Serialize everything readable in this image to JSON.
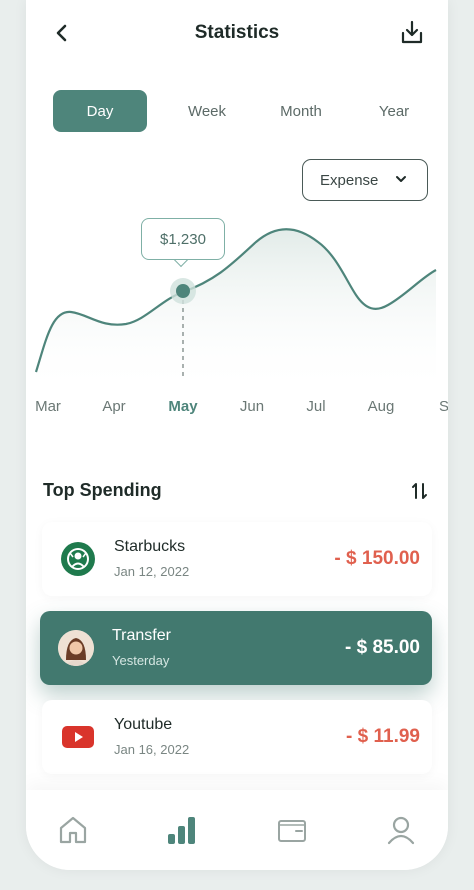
{
  "header": {
    "title": "Statistics",
    "back_icon": "chevron-left-icon",
    "download_icon": "download-icon"
  },
  "tabs": [
    {
      "label": "Day",
      "active": true
    },
    {
      "label": "Week",
      "active": false
    },
    {
      "label": "Month",
      "active": false
    },
    {
      "label": "Year",
      "active": false
    }
  ],
  "filter": {
    "selected": "Expense",
    "icon": "chevron-down-icon"
  },
  "chart_data": {
    "type": "area",
    "categories": [
      "Mar",
      "Apr",
      "May",
      "Jun",
      "Jul",
      "Aug",
      "S"
    ],
    "highlight": {
      "category": "May",
      "label": "$1,230"
    },
    "series_color": "#4e857b",
    "grid": false
  },
  "spending": {
    "title": "Top Spending",
    "sort_icon": "sort-icon",
    "items": [
      {
        "name": "Starbucks",
        "date": "Jan 12, 2022",
        "amount": "- $ 150.00",
        "icon": "starbucks-logo-icon",
        "active": false
      },
      {
        "name": "Transfer",
        "date": "Yesterday",
        "amount": "- $ 85.00",
        "icon": "avatar-icon",
        "active": true
      },
      {
        "name": "Youtube",
        "date": "Jan 16, 2022",
        "amount": "- $ 11.99",
        "icon": "youtube-logo-icon",
        "active": false
      }
    ]
  },
  "nav": {
    "items": [
      {
        "icon": "home-icon",
        "active": false
      },
      {
        "icon": "chart-icon",
        "active": true
      },
      {
        "icon": "wallet-icon",
        "active": false
      },
      {
        "icon": "user-icon",
        "active": false
      }
    ]
  },
  "colors": {
    "accent": "#4e857b",
    "negative": "#e0604e"
  }
}
